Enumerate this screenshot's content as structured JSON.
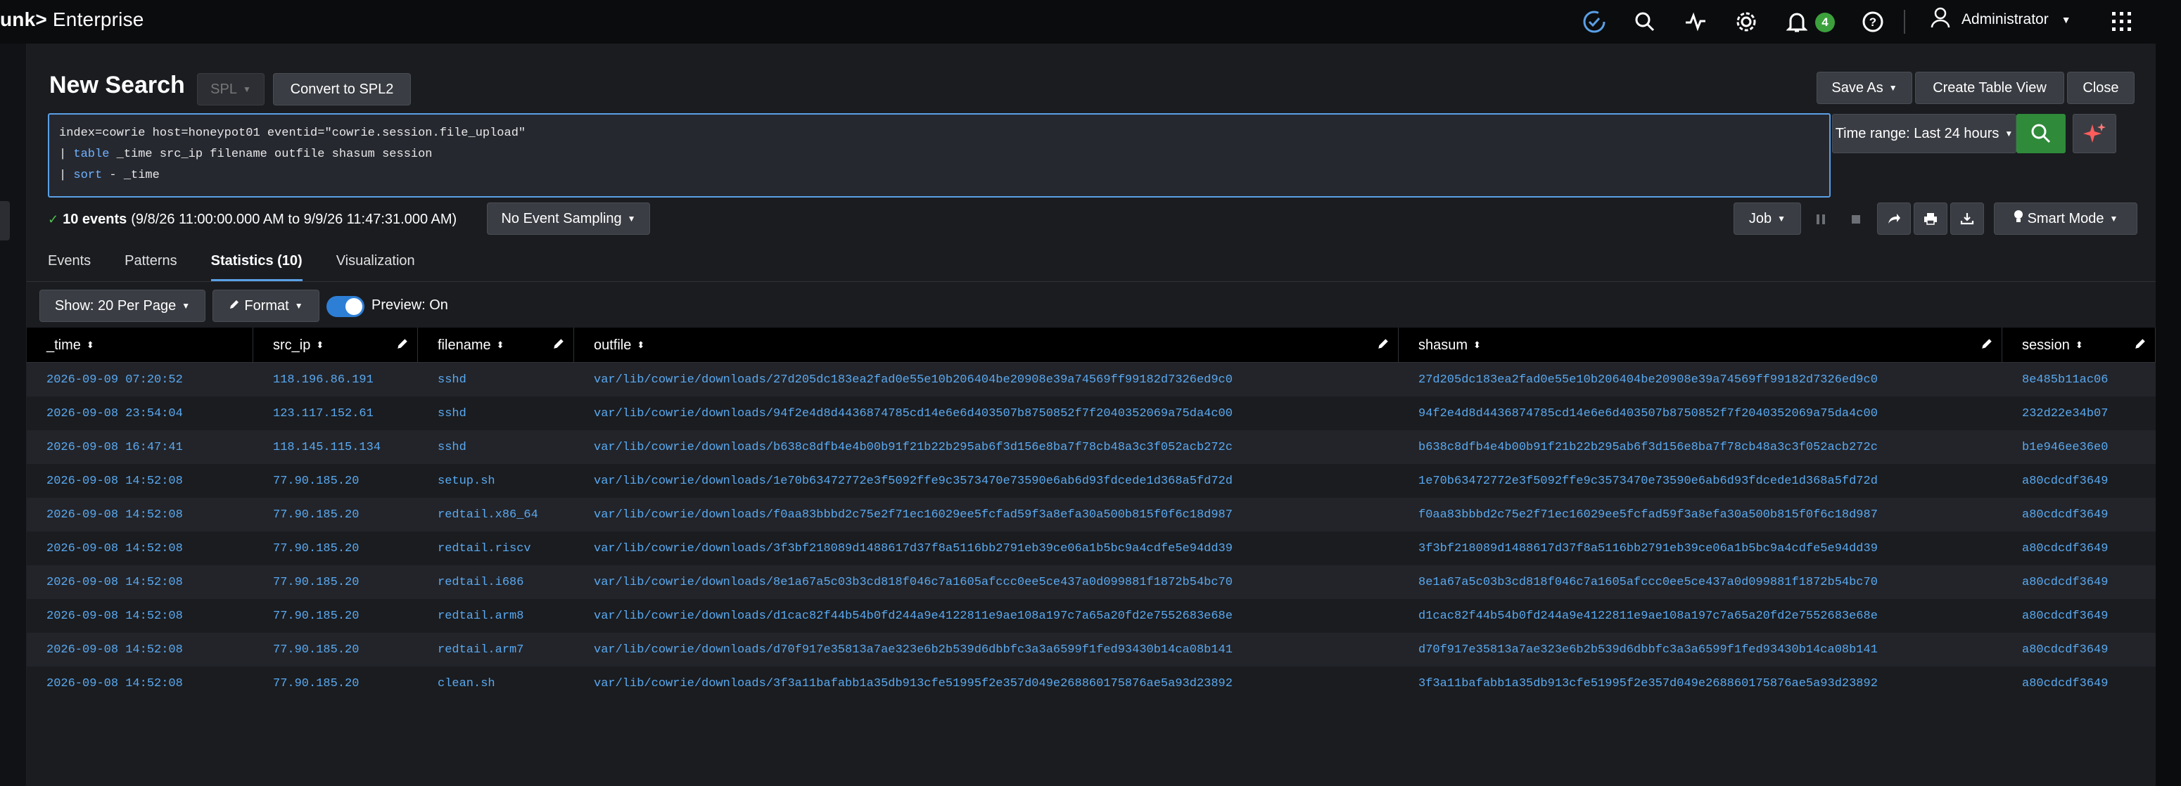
{
  "app": {
    "brand": "unk>",
    "brand_suffix": "Enterprise",
    "notifications_count": "4",
    "user": "Administrator"
  },
  "search": {
    "title": "New Search",
    "spl_label": "SPL",
    "convert_label": "Convert to SPL2",
    "save_as_label": "Save As",
    "create_table_label": "Create Table View",
    "close_label": "Close",
    "query_line1": "index=cowrie host=honeypot01 eventid=\"cowrie.session.file_upload\"",
    "query_line2_kw": "table",
    "query_line2_rest": " _time src_ip filename outfile shasum session",
    "query_line3_kw": "sort",
    "query_line3_rest": " - _time",
    "pipe": "| ",
    "time_range_label": "Time range: Last 24 hours"
  },
  "status": {
    "events_count": "10 events",
    "events_range": "(9/8/26 11:00:00.000 AM to 9/9/26 11:47:31.000 AM)",
    "sampling_label": "No Event Sampling",
    "job_label": "Job",
    "mode_label": "Smart Mode"
  },
  "tabs": [
    "Events",
    "Patterns",
    "Statistics (10)",
    "Visualization"
  ],
  "toolbar": {
    "per_page_label": "Show: 20 Per Page",
    "format_label": "Format",
    "preview_label": "Preview: On"
  },
  "table": {
    "headers": [
      "_time",
      "src_ip",
      "filename",
      "outfile",
      "shasum",
      "session"
    ],
    "rows": [
      [
        "2026-09-09 07:20:52",
        "118.196.86.191",
        "sshd",
        "var/lib/cowrie/downloads/27d205dc183ea2fad0e55e10b206404be20908e39a74569ff99182d7326ed9c0",
        "27d205dc183ea2fad0e55e10b206404be20908e39a74569ff99182d7326ed9c0",
        "8e485b11ac06"
      ],
      [
        "2026-09-08 23:54:04",
        "123.117.152.61",
        "sshd",
        "var/lib/cowrie/downloads/94f2e4d8d4436874785cd14e6e6d403507b8750852f7f2040352069a75da4c00",
        "94f2e4d8d4436874785cd14e6e6d403507b8750852f7f2040352069a75da4c00",
        "232d22e34b07"
      ],
      [
        "2026-09-08 16:47:41",
        "118.145.115.134",
        "sshd",
        "var/lib/cowrie/downloads/b638c8dfb4e4b00b91f21b22b295ab6f3d156e8ba7f78cb48a3c3f052acb272c",
        "b638c8dfb4e4b00b91f21b22b295ab6f3d156e8ba7f78cb48a3c3f052acb272c",
        "b1e946ee36e0"
      ],
      [
        "2026-09-08 14:52:08",
        "77.90.185.20",
        "setup.sh",
        "var/lib/cowrie/downloads/1e70b63472772e3f5092ffe9c3573470e73590e6ab6d93fdcede1d368a5fd72d",
        "1e70b63472772e3f5092ffe9c3573470e73590e6ab6d93fdcede1d368a5fd72d",
        "a80cdcdf3649"
      ],
      [
        "2026-09-08 14:52:08",
        "77.90.185.20",
        "redtail.x86_64",
        "var/lib/cowrie/downloads/f0aa83bbbd2c75e2f71ec16029ee5fcfad59f3a8efa30a500b815f0f6c18d987",
        "f0aa83bbbd2c75e2f71ec16029ee5fcfad59f3a8efa30a500b815f0f6c18d987",
        "a80cdcdf3649"
      ],
      [
        "2026-09-08 14:52:08",
        "77.90.185.20",
        "redtail.riscv",
        "var/lib/cowrie/downloads/3f3bf218089d1488617d37f8a5116bb2791eb39ce06a1b5bc9a4cdfe5e94dd39",
        "3f3bf218089d1488617d37f8a5116bb2791eb39ce06a1b5bc9a4cdfe5e94dd39",
        "a80cdcdf3649"
      ],
      [
        "2026-09-08 14:52:08",
        "77.90.185.20",
        "redtail.i686",
        "var/lib/cowrie/downloads/8e1a67a5c03b3cd818f046c7a1605afccc0ee5ce437a0d099881f1872b54bc70",
        "8e1a67a5c03b3cd818f046c7a1605afccc0ee5ce437a0d099881f1872b54bc70",
        "a80cdcdf3649"
      ],
      [
        "2026-09-08 14:52:08",
        "77.90.185.20",
        "redtail.arm8",
        "var/lib/cowrie/downloads/d1cac82f44b54b0fd244a9e4122811e9ae108a197c7a65a20fd2e7552683e68e",
        "d1cac82f44b54b0fd244a9e4122811e9ae108a197c7a65a20fd2e7552683e68e",
        "a80cdcdf3649"
      ],
      [
        "2026-09-08 14:52:08",
        "77.90.185.20",
        "redtail.arm7",
        "var/lib/cowrie/downloads/d70f917e35813a7ae323e6b2b539d6dbbfc3a3a6599f1fed93430b14ca08b141",
        "d70f917e35813a7ae323e6b2b539d6dbbfc3a3a6599f1fed93430b14ca08b141",
        "a80cdcdf3649"
      ],
      [
        "2026-09-08 14:52:08",
        "77.90.185.20",
        "clean.sh",
        "var/lib/cowrie/downloads/3f3a11bafabb1a35db913cfe51995f2e357d049e268860175876ae5a93d23892",
        "3f3a11bafabb1a35db913cfe51995f2e357d049e268860175876ae5a93d23892",
        "a80cdcdf3649"
      ]
    ]
  },
  "colors": {
    "accent": "#5aa0e6",
    "link": "#5aa9f0",
    "search_green": "#2f8a3a",
    "badge_green": "#3ca13c",
    "ai_icon": "#ff5c5c"
  },
  "icons": [
    "status-check-icon",
    "search-icon",
    "activity-icon",
    "gear-icon",
    "bell-icon",
    "help-icon",
    "user-icon",
    "app-grid-icon",
    "pause-icon",
    "stop-icon",
    "share-icon",
    "print-icon",
    "export-icon",
    "lightbulb-icon",
    "pencil-icon",
    "sort-icon",
    "sparkle-icon"
  ]
}
